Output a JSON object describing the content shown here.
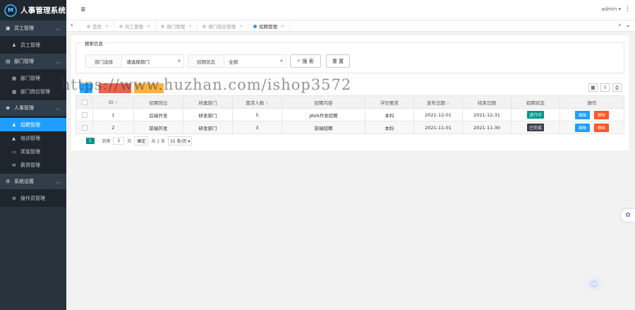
{
  "app": {
    "logo_glyph": "M",
    "title": "人事管理系统"
  },
  "topbar": {
    "user": "admin ▾",
    "more": "⋮",
    "menu_toggle": "≣"
  },
  "sidebar": [
    {
      "label": "员工管理",
      "icon": "id-card-icon",
      "items": [
        {
          "label": "员工管理",
          "icon": "user-icon"
        }
      ]
    },
    {
      "label": "部门管理",
      "icon": "building-icon",
      "items": [
        {
          "label": "部门管理",
          "icon": "list-icon"
        },
        {
          "label": "部门岗位管理",
          "icon": "list-icon"
        }
      ]
    },
    {
      "label": "人事管理",
      "icon": "users-icon",
      "items": [
        {
          "label": "招聘管理",
          "icon": "user-add-icon",
          "active": true
        },
        {
          "label": "培训管理",
          "icon": "graduation-icon"
        },
        {
          "label": "奖惩管理",
          "icon": "monitor-icon"
        },
        {
          "label": "薪资管理",
          "icon": "mail-icon"
        }
      ]
    },
    {
      "label": "系统设置",
      "icon": "gears-icon",
      "items": [
        {
          "label": "操作员管理",
          "icon": "gears-icon"
        }
      ]
    }
  ],
  "tabs": [
    {
      "label": "首页"
    },
    {
      "label": "员工管理"
    },
    {
      "label": "部门管理"
    },
    {
      "label": "部门岗位管理"
    },
    {
      "label": "招聘管理",
      "active": true
    }
  ],
  "search": {
    "legend": "搜索信息",
    "dept_label": "部门选择",
    "dept_value": "请选择部门",
    "status_label": "招聘状态",
    "status_value": "全部",
    "search_button": "搜 索",
    "reset_button": "重 置"
  },
  "toolbar": {
    "add_label": "添加"
  },
  "table": {
    "headers": [
      "ID",
      "招聘岗位",
      "所属部门",
      "需求人数",
      "招聘内容",
      "学历要求",
      "发布日期",
      "结束日期",
      "招聘状态",
      "操作"
    ],
    "rows": [
      {
        "id": "1",
        "position": "后端开发",
        "dept": "研发部门",
        "count": "5",
        "content": "JAVA开发招聘",
        "edu": "本科",
        "start": "2021-12-01",
        "end": "2021-12-31",
        "status": "进行中",
        "status_color": "#009688"
      },
      {
        "id": "2",
        "position": "前端开发",
        "dept": "研发部门",
        "count": "3",
        "content": "前端招聘",
        "edu": "本科",
        "start": "2021-11-01",
        "end": "2021-11-30",
        "status": "已完成",
        "status_color": "#393d49"
      }
    ],
    "edit_label": "编辑",
    "delete_label": "删除"
  },
  "pager": {
    "current": "1",
    "goto_label": "到第",
    "goto_value": "1",
    "page_unit": "页",
    "confirm": "确定",
    "total": "共 2 条",
    "per_page": "15 条/页 ▾"
  },
  "watermark": "https://www.huzhan.com/ishop3572"
}
